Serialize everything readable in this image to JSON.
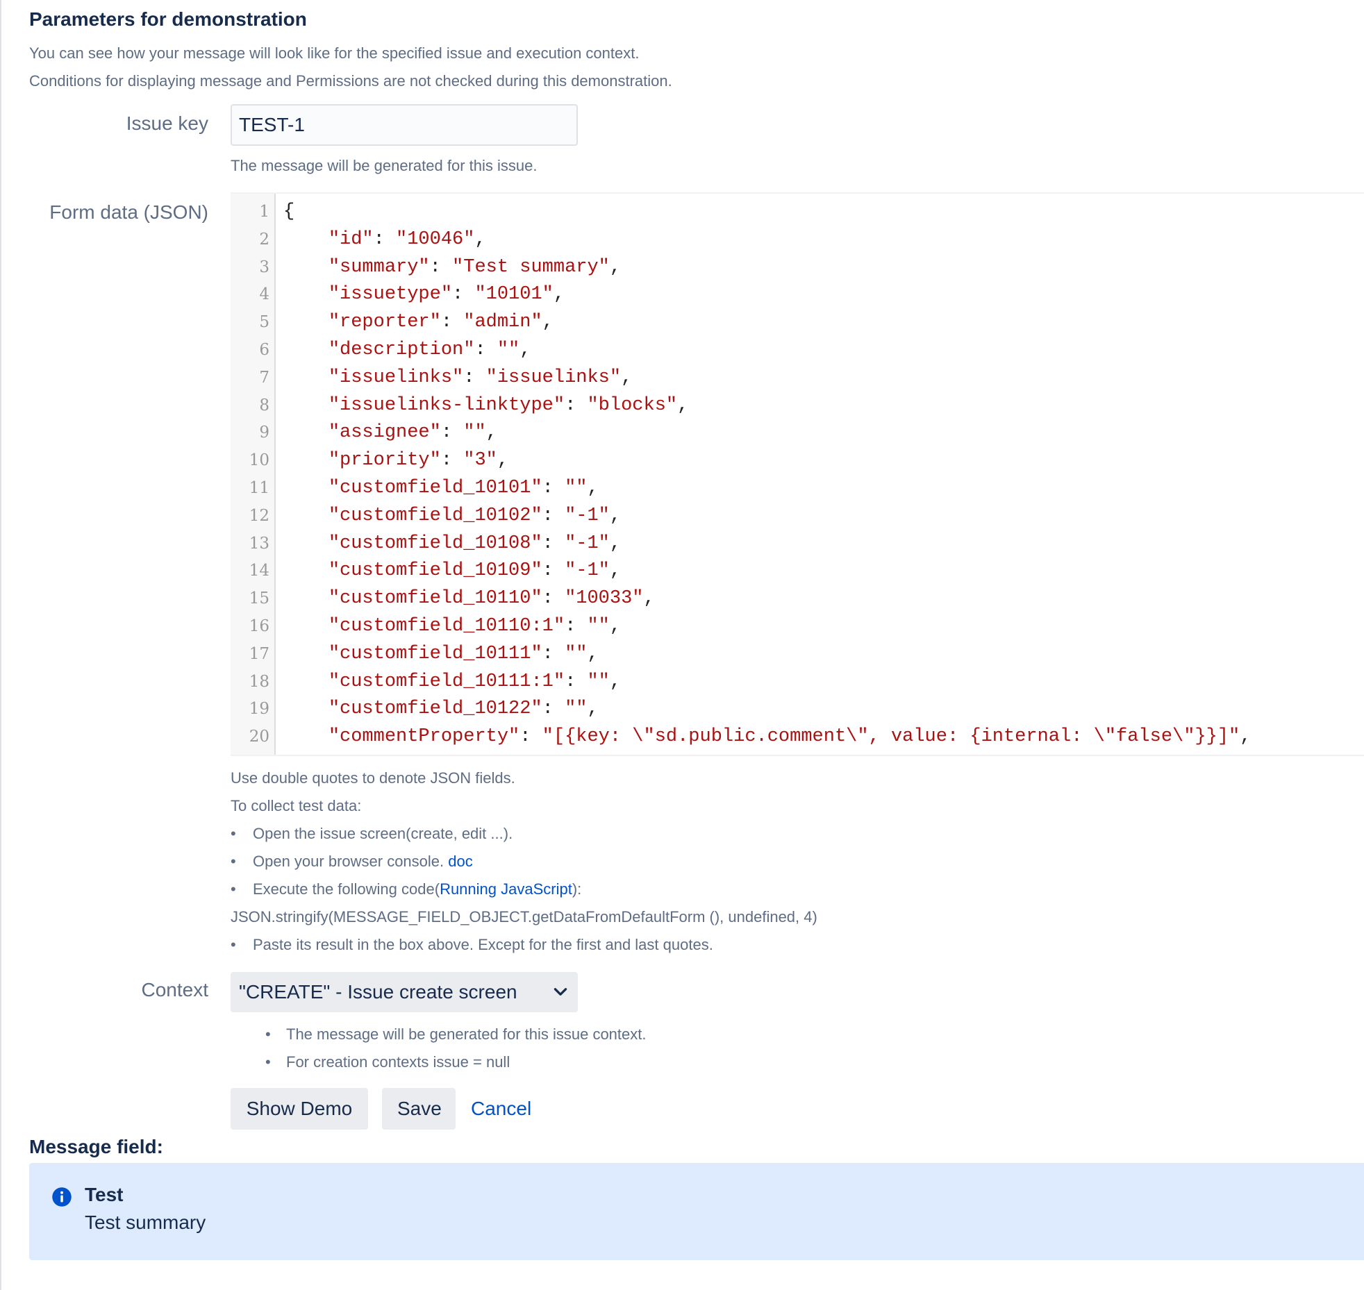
{
  "section": {
    "title": "Parameters for demonstration",
    "intro": [
      "You can see how your message will look like for the specified issue and execution context.",
      "Conditions for displaying message and Permissions are not checked during this demonstration."
    ]
  },
  "issue_key": {
    "label": "Issue key",
    "value": "TEST-1",
    "help": "The message will be generated for this issue."
  },
  "form_data": {
    "label": "Form data (JSON)",
    "lines": [
      {
        "num": "1",
        "key": "",
        "value": "",
        "text": "{"
      },
      {
        "num": "2",
        "key": "\"id\"",
        "value": "\"10046\"",
        "text": ""
      },
      {
        "num": "3",
        "key": "\"summary\"",
        "value": "\"Test summary\"",
        "text": ""
      },
      {
        "num": "4",
        "key": "\"issuetype\"",
        "value": "\"10101\"",
        "text": ""
      },
      {
        "num": "5",
        "key": "\"reporter\"",
        "value": "\"admin\"",
        "text": ""
      },
      {
        "num": "6",
        "key": "\"description\"",
        "value": "\"\"",
        "text": ""
      },
      {
        "num": "7",
        "key": "\"issuelinks\"",
        "value": "\"issuelinks\"",
        "text": ""
      },
      {
        "num": "8",
        "key": "\"issuelinks-linktype\"",
        "value": "\"blocks\"",
        "text": ""
      },
      {
        "num": "9",
        "key": "\"assignee\"",
        "value": "\"\"",
        "text": ""
      },
      {
        "num": "10",
        "key": "\"priority\"",
        "value": "\"3\"",
        "text": ""
      },
      {
        "num": "11",
        "key": "\"customfield_10101\"",
        "value": "\"\"",
        "text": ""
      },
      {
        "num": "12",
        "key": "\"customfield_10102\"",
        "value": "\"-1\"",
        "text": ""
      },
      {
        "num": "13",
        "key": "\"customfield_10108\"",
        "value": "\"-1\"",
        "text": ""
      },
      {
        "num": "14",
        "key": "\"customfield_10109\"",
        "value": "\"-1\"",
        "text": ""
      },
      {
        "num": "15",
        "key": "\"customfield_10110\"",
        "value": "\"10033\"",
        "text": ""
      },
      {
        "num": "16",
        "key": "\"customfield_10110:1\"",
        "value": "\"\"",
        "text": ""
      },
      {
        "num": "17",
        "key": "\"customfield_10111\"",
        "value": "\"\"",
        "text": ""
      },
      {
        "num": "18",
        "key": "\"customfield_10111:1\"",
        "value": "\"\"",
        "text": ""
      },
      {
        "num": "19",
        "key": "\"customfield_10122\"",
        "value": "\"\"",
        "text": ""
      },
      {
        "num": "20",
        "key": "\"commentProperty\"",
        "value": "\"[{key: \\\"sd.public.comment\\\", value: {internal: \\\"false\\\"}}]\"",
        "text": ""
      }
    ],
    "help_quotes": "Use double quotes to denote JSON fields.",
    "collect_title": "To collect test data:",
    "step1": "Open the issue screen(create, edit ...).",
    "step2_text": "Open your browser console. ",
    "step2_link": "doc",
    "step3_text": "Execute the following code(",
    "step3_link": "Running JavaScript",
    "step3_end": "):",
    "code_snippet": "JSON.stringify(MESSAGE_FIELD_OBJECT.getDataFromDefaultForm (), undefined, 4)",
    "step4": "Paste its result in the box above. Except for the first and last quotes."
  },
  "context": {
    "label": "Context",
    "selected": "\"CREATE\" - Issue create screen",
    "notes": [
      "The message will be generated for this issue context.",
      "For creation contexts issue = null"
    ]
  },
  "actions": {
    "show_demo": "Show Demo",
    "save": "Save",
    "cancel": "Cancel"
  },
  "message_field": {
    "title": "Message field:",
    "heading": "Test",
    "body": "Test summary",
    "icon": "info-icon"
  },
  "colors": {
    "link": "#0052cc",
    "json_string": "#aa1111",
    "message_bg": "#deebff",
    "info_icon": "#0052cc"
  }
}
